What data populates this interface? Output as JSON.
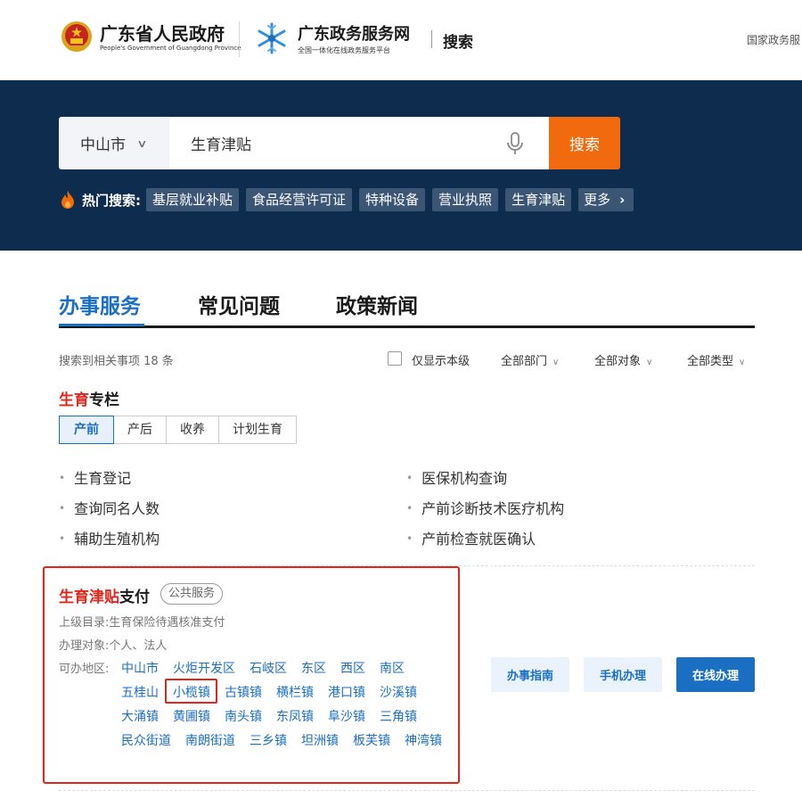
{
  "header": {
    "gov_name": "广东省人民政府",
    "gov_name_en": "People's Government of Guangdong Province",
    "site_name": "广东政务服务网",
    "site_sub": "全国一体化在线政务服务平台",
    "page_label": "搜索",
    "national_link": "国家政务服"
  },
  "search": {
    "city": "中山市",
    "query": "生育津贴",
    "button": "搜索",
    "hot_label": "热门搜索:",
    "hot_tags": [
      "基层就业补贴",
      "食品经营许可证",
      "特种设备",
      "营业执照",
      "生育津贴"
    ],
    "more": "更多"
  },
  "tabs": [
    "办事服务",
    "常见问题",
    "政策新闻"
  ],
  "filters": {
    "result_count": "搜索到相关事项 18 条",
    "only_local": "仅显示本级",
    "dept": "全部部门",
    "target": "全部对象",
    "type": "全部类型"
  },
  "column": {
    "title_red": "生育",
    "title_rest": "专栏",
    "subtabs": [
      "产前",
      "产后",
      "收养",
      "计划生育"
    ],
    "items": [
      "生育登记",
      "医保机构查询",
      "查询同名人数",
      "产前诊断技术医疗机构",
      "辅助生殖机构",
      "产前检查就医确认"
    ]
  },
  "service": {
    "title_red": "生育津贴",
    "title_rest": "支付",
    "badge": "公共服务",
    "parent_label": "上级目录:",
    "parent_value": "生育保险待遇核准支付",
    "target_label": "办理对象:",
    "target_value": "个人、法人",
    "region_label": "可办地区:",
    "regions": [
      "中山市",
      "火炬开发区",
      "石岐区",
      "东区",
      "西区",
      "南区",
      "五桂山",
      "小榄镇",
      "古镇镇",
      "横栏镇",
      "港口镇",
      "沙溪镇",
      "大涌镇",
      "黄圃镇",
      "南头镇",
      "东凤镇",
      "阜沙镇",
      "三角镇",
      "民众街道",
      "南朗街道",
      "三乡镇",
      "坦洲镇",
      "板芙镇",
      "神湾镇"
    ],
    "btn_guide": "办事指南",
    "btn_mobile": "手机办理",
    "btn_online": "在线办理"
  },
  "colors": {
    "band": "#0e2c4d",
    "accent_blue": "#1a6fc3",
    "search_orange": "#f16a0d",
    "highlight_red": "#e1251b"
  }
}
